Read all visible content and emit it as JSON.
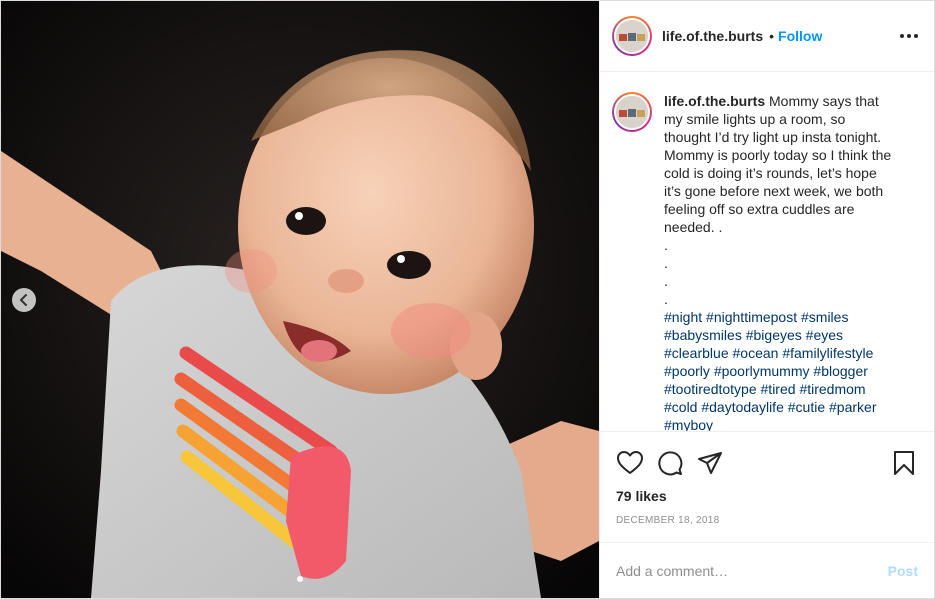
{
  "header": {
    "username": "life.of.the.burts",
    "separator": "•",
    "follow_label": "Follow"
  },
  "caption": {
    "username": "life.of.the.burts",
    "lines": [
      "Mommy says that",
      "my smile lights up a room, so",
      "thought I’d try light up insta tonight.",
      "Mommy is poorly today so I think the",
      "cold is doing it’s rounds, let’s hope",
      "it’s gone before next week, we both",
      "feeling off so extra cuddles are",
      "needed. .",
      ".",
      ".",
      ".",
      "."
    ],
    "hashtag_lines": [
      [
        "#night",
        "#nighttimepost",
        "#smiles"
      ],
      [
        "#babysmiles",
        "#bigeyes",
        "#eyes"
      ],
      [
        "#clearblue",
        "#ocean",
        "#familylifestyle"
      ],
      [
        "#poorly",
        "#poorlymummy",
        "#blogger"
      ],
      [
        "#tootiredtotype",
        "#tired",
        "#tiredmom"
      ],
      [
        "#cold",
        "#daytodaylife",
        "#cutie",
        "#parker"
      ],
      [
        "#myboy"
      ]
    ]
  },
  "likes": "79 likes",
  "date": "DECEMBER 18, 2018",
  "comment_box": {
    "placeholder": "Add a comment…",
    "post_label": "Post"
  },
  "colors": {
    "link_blue": "#0095f6",
    "hashtag": "#00376b",
    "post_disabled": "#b3dbff"
  },
  "icons": {
    "prev": "chevron-left-icon",
    "like": "heart-icon",
    "comment": "comment-icon",
    "share": "paper-plane-icon",
    "save": "bookmark-icon",
    "more": "more-dots-icon"
  }
}
